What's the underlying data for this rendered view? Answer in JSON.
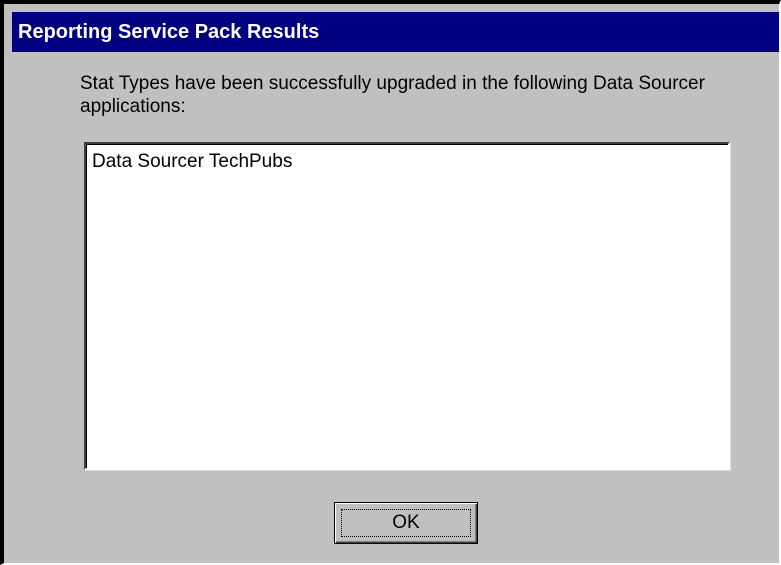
{
  "dialog": {
    "title": "Reporting Service Pack Results",
    "message": "Stat Types have been successfully upgraded in the following Data Sourcer applications:",
    "list_items": [
      "Data Sourcer TechPubs"
    ],
    "ok_label": "OK"
  },
  "colors": {
    "titlebar": "#000080",
    "dialog_background": "#c0c0c0",
    "listbox_background": "#ffffff"
  }
}
